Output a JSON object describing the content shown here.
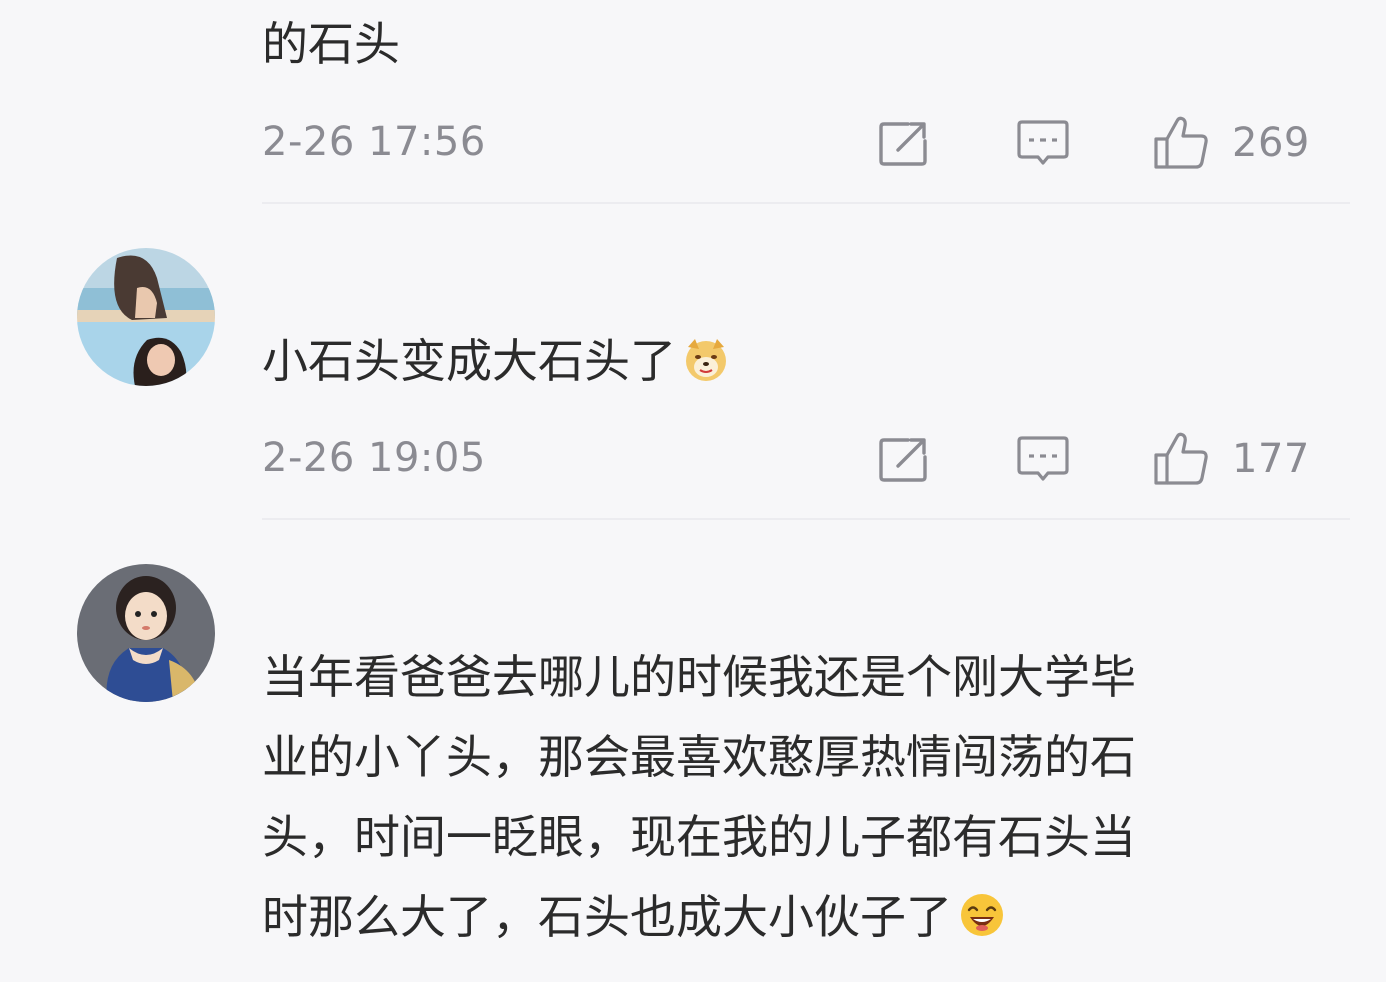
{
  "comments": [
    {
      "text": "的石头",
      "timestamp": "2-26 17:56",
      "likes": "269"
    },
    {
      "username": "",
      "text": "小石头变成大石头了",
      "emoji": "doge-emoji",
      "timestamp": "2-26 19:05",
      "likes": "177"
    },
    {
      "username": "",
      "text_lines": [
        "当年看爸爸去哪儿的时候我还是个刚大学毕",
        "业的小丫头，那会最喜欢憨厚热情闯荡的石",
        "头，时间一眨眼，现在我的儿子都有石头当",
        "时那么大了，石头也成大小伙子了"
      ],
      "emoji": "laughing-emoji"
    }
  ],
  "icons": {
    "share": "share-icon",
    "comment": "comment-icon",
    "like": "thumbs-up-icon"
  },
  "colors": {
    "background": "#f7f7f9",
    "text": "#2b2b2b",
    "meta": "#8b8b92",
    "divider": "#ececf0"
  }
}
